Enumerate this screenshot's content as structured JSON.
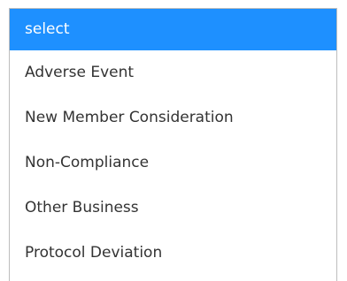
{
  "dropdown": {
    "selected_index": 0,
    "accent_color": "#1e90ff",
    "options": [
      {
        "label": "select"
      },
      {
        "label": "Adverse Event"
      },
      {
        "label": "New Member Consideration"
      },
      {
        "label": "Non-Compliance"
      },
      {
        "label": "Other Business"
      },
      {
        "label": "Protocol Deviation"
      }
    ]
  }
}
